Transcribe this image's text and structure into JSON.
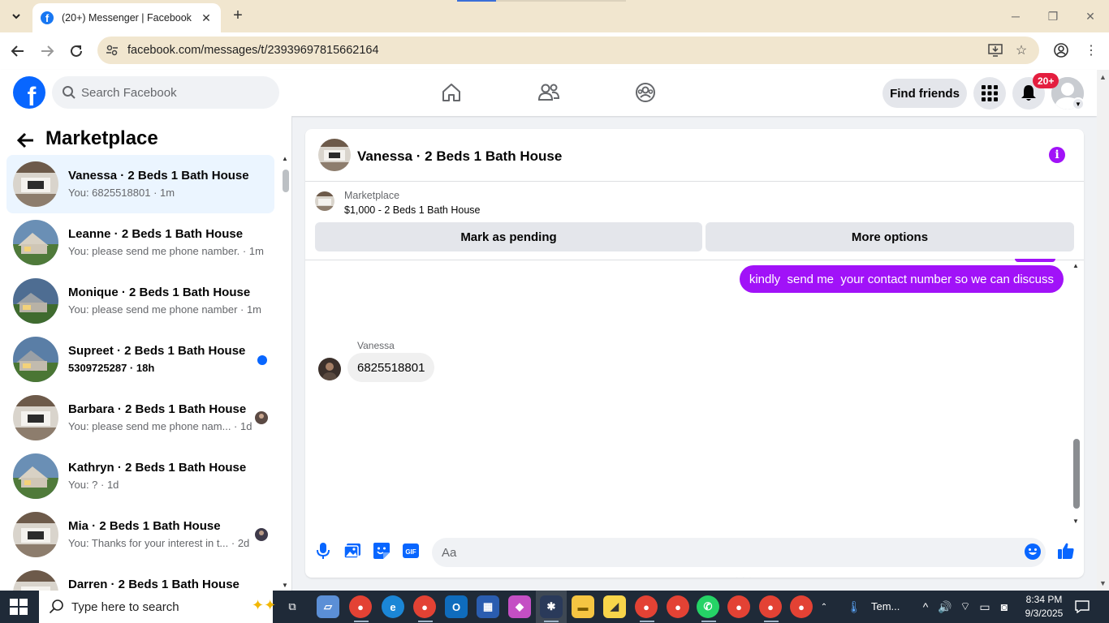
{
  "browser": {
    "tab_title": "(20+) Messenger | Facebook",
    "url": "facebook.com/messages/t/23939697815662164"
  },
  "header": {
    "search_placeholder": "Search Facebook",
    "find_friends": "Find friends",
    "notification_badge": "20+"
  },
  "sidebar": {
    "title": "Marketplace",
    "conversations": [
      {
        "name": "Vanessa · 2 Beds 1 Bath House",
        "preview": "You: 6825518801 · 1m",
        "active": true
      },
      {
        "name": "Leanne · 2 Beds 1 Bath House",
        "preview": "You: please send me phone namber. · 1m"
      },
      {
        "name": "Monique · 2 Beds 1 Bath House",
        "preview": "You: please send me phone namber · 1m"
      },
      {
        "name": "Supreet · 2 Beds 1 Bath House",
        "preview": "5309725287 · 18h",
        "unread": true
      },
      {
        "name": "Barbara · 2 Beds 1 Bath House",
        "preview": "You: please send me phone nam... · 1d"
      },
      {
        "name": "Kathryn · 2 Beds 1 Bath House",
        "preview": "You: ? · 1d"
      },
      {
        "name": "Mia · 2 Beds 1 Bath House",
        "preview": "You: Thanks for your interest in t... · 2d"
      },
      {
        "name": "Darren · 2 Beds 1 Bath House",
        "preview": ""
      }
    ]
  },
  "chat": {
    "title": "Vanessa · 2 Beds 1 Bath House",
    "listing_source": "Marketplace",
    "listing_price": "$1,000 - 2 Beds 1 Bath House",
    "mark_pending": "Mark as pending",
    "more_options": "More options",
    "outgoing_message": "kindly  send me  your contact number so we can discuss",
    "sender_name": "Vanessa",
    "incoming_message": "6825518801",
    "composer_placeholder": "Aa"
  },
  "taskbar": {
    "search_placeholder": "Type here to search",
    "weather_text": "Tem...",
    "time": "8:34 PM",
    "date": "9/3/2025"
  },
  "colors": {
    "facebook_blue": "#0866ff",
    "messenger_purple": "#a112f8",
    "notification_red": "#e41e3f"
  }
}
